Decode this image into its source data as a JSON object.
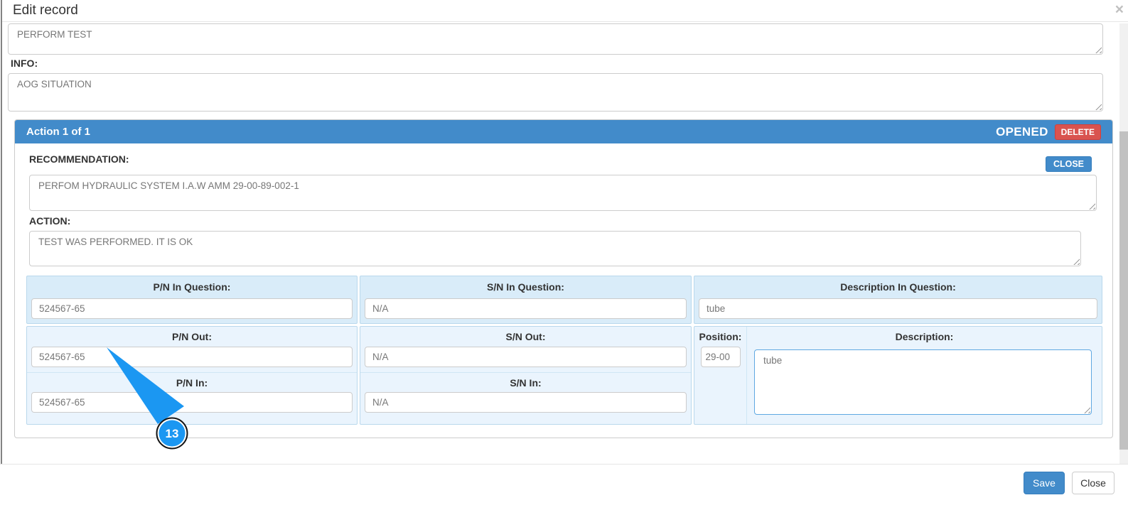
{
  "modal": {
    "title": "Edit record",
    "close_icon": "×"
  },
  "fields": {
    "top_textarea_value": "PERFORM TEST",
    "info_label": "INFO:",
    "info_value": "AOG SITUATION"
  },
  "action_panel": {
    "title": "Action 1 of 1",
    "status": "OPENED",
    "delete_label": "DELETE",
    "close_label": "CLOSE",
    "recommendation_label": "RECOMMENDATION:",
    "recommendation_value": "PERFOM HYDRAULIC SYSTEM I.A.W AMM 29-00-89-002-1",
    "action_label": "ACTION:",
    "action_value": "TEST WAS PERFORMED. IT IS OK",
    "parts_table": {
      "in_question": {
        "pn_label": "P/N In Question:",
        "pn_value": "524567-65",
        "sn_label": "S/N In Question:",
        "sn_value": "N/A",
        "desc_label": "Description In Question:",
        "desc_value": "tube"
      },
      "out": {
        "pn_label": "P/N Out:",
        "pn_value": "524567-65",
        "sn_label": "S/N Out:",
        "sn_value": "N/A"
      },
      "in": {
        "pn_label": "P/N In:",
        "pn_value": "524567-65",
        "sn_label": "S/N In:",
        "sn_value": "N/A"
      },
      "position_label": "Position:",
      "position_value": "29-00",
      "description_label": "Description:",
      "description_value": "tube"
    }
  },
  "footer": {
    "save_label": "Save",
    "close_label": "Close"
  },
  "annotation": {
    "step_number": "13"
  },
  "colors": {
    "primary_blue": "#428bca",
    "danger_red": "#d9534f",
    "annotation_blue": "#1b97f2",
    "table_header_bg": "#d9ecf9",
    "table_body_bg": "#eaf4fd",
    "focused_border": "#5fa8e2"
  }
}
